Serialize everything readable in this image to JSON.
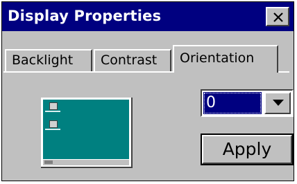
{
  "window": {
    "title": "Display Properties"
  },
  "titlebar": {
    "close_icon": "close-icon"
  },
  "tabs": [
    {
      "label": "Backlight",
      "active": false
    },
    {
      "label": "Contrast",
      "active": false
    },
    {
      "label": "Orientation",
      "active": true
    }
  ],
  "orientation": {
    "select_value": "0",
    "dropdown_icon": "chevron-down-icon",
    "apply_label": "Apply"
  },
  "colors": {
    "title_bar": "#000080",
    "window_bg": "#c0c0c0",
    "desktop_preview": "#008080",
    "selection": "#000080"
  }
}
